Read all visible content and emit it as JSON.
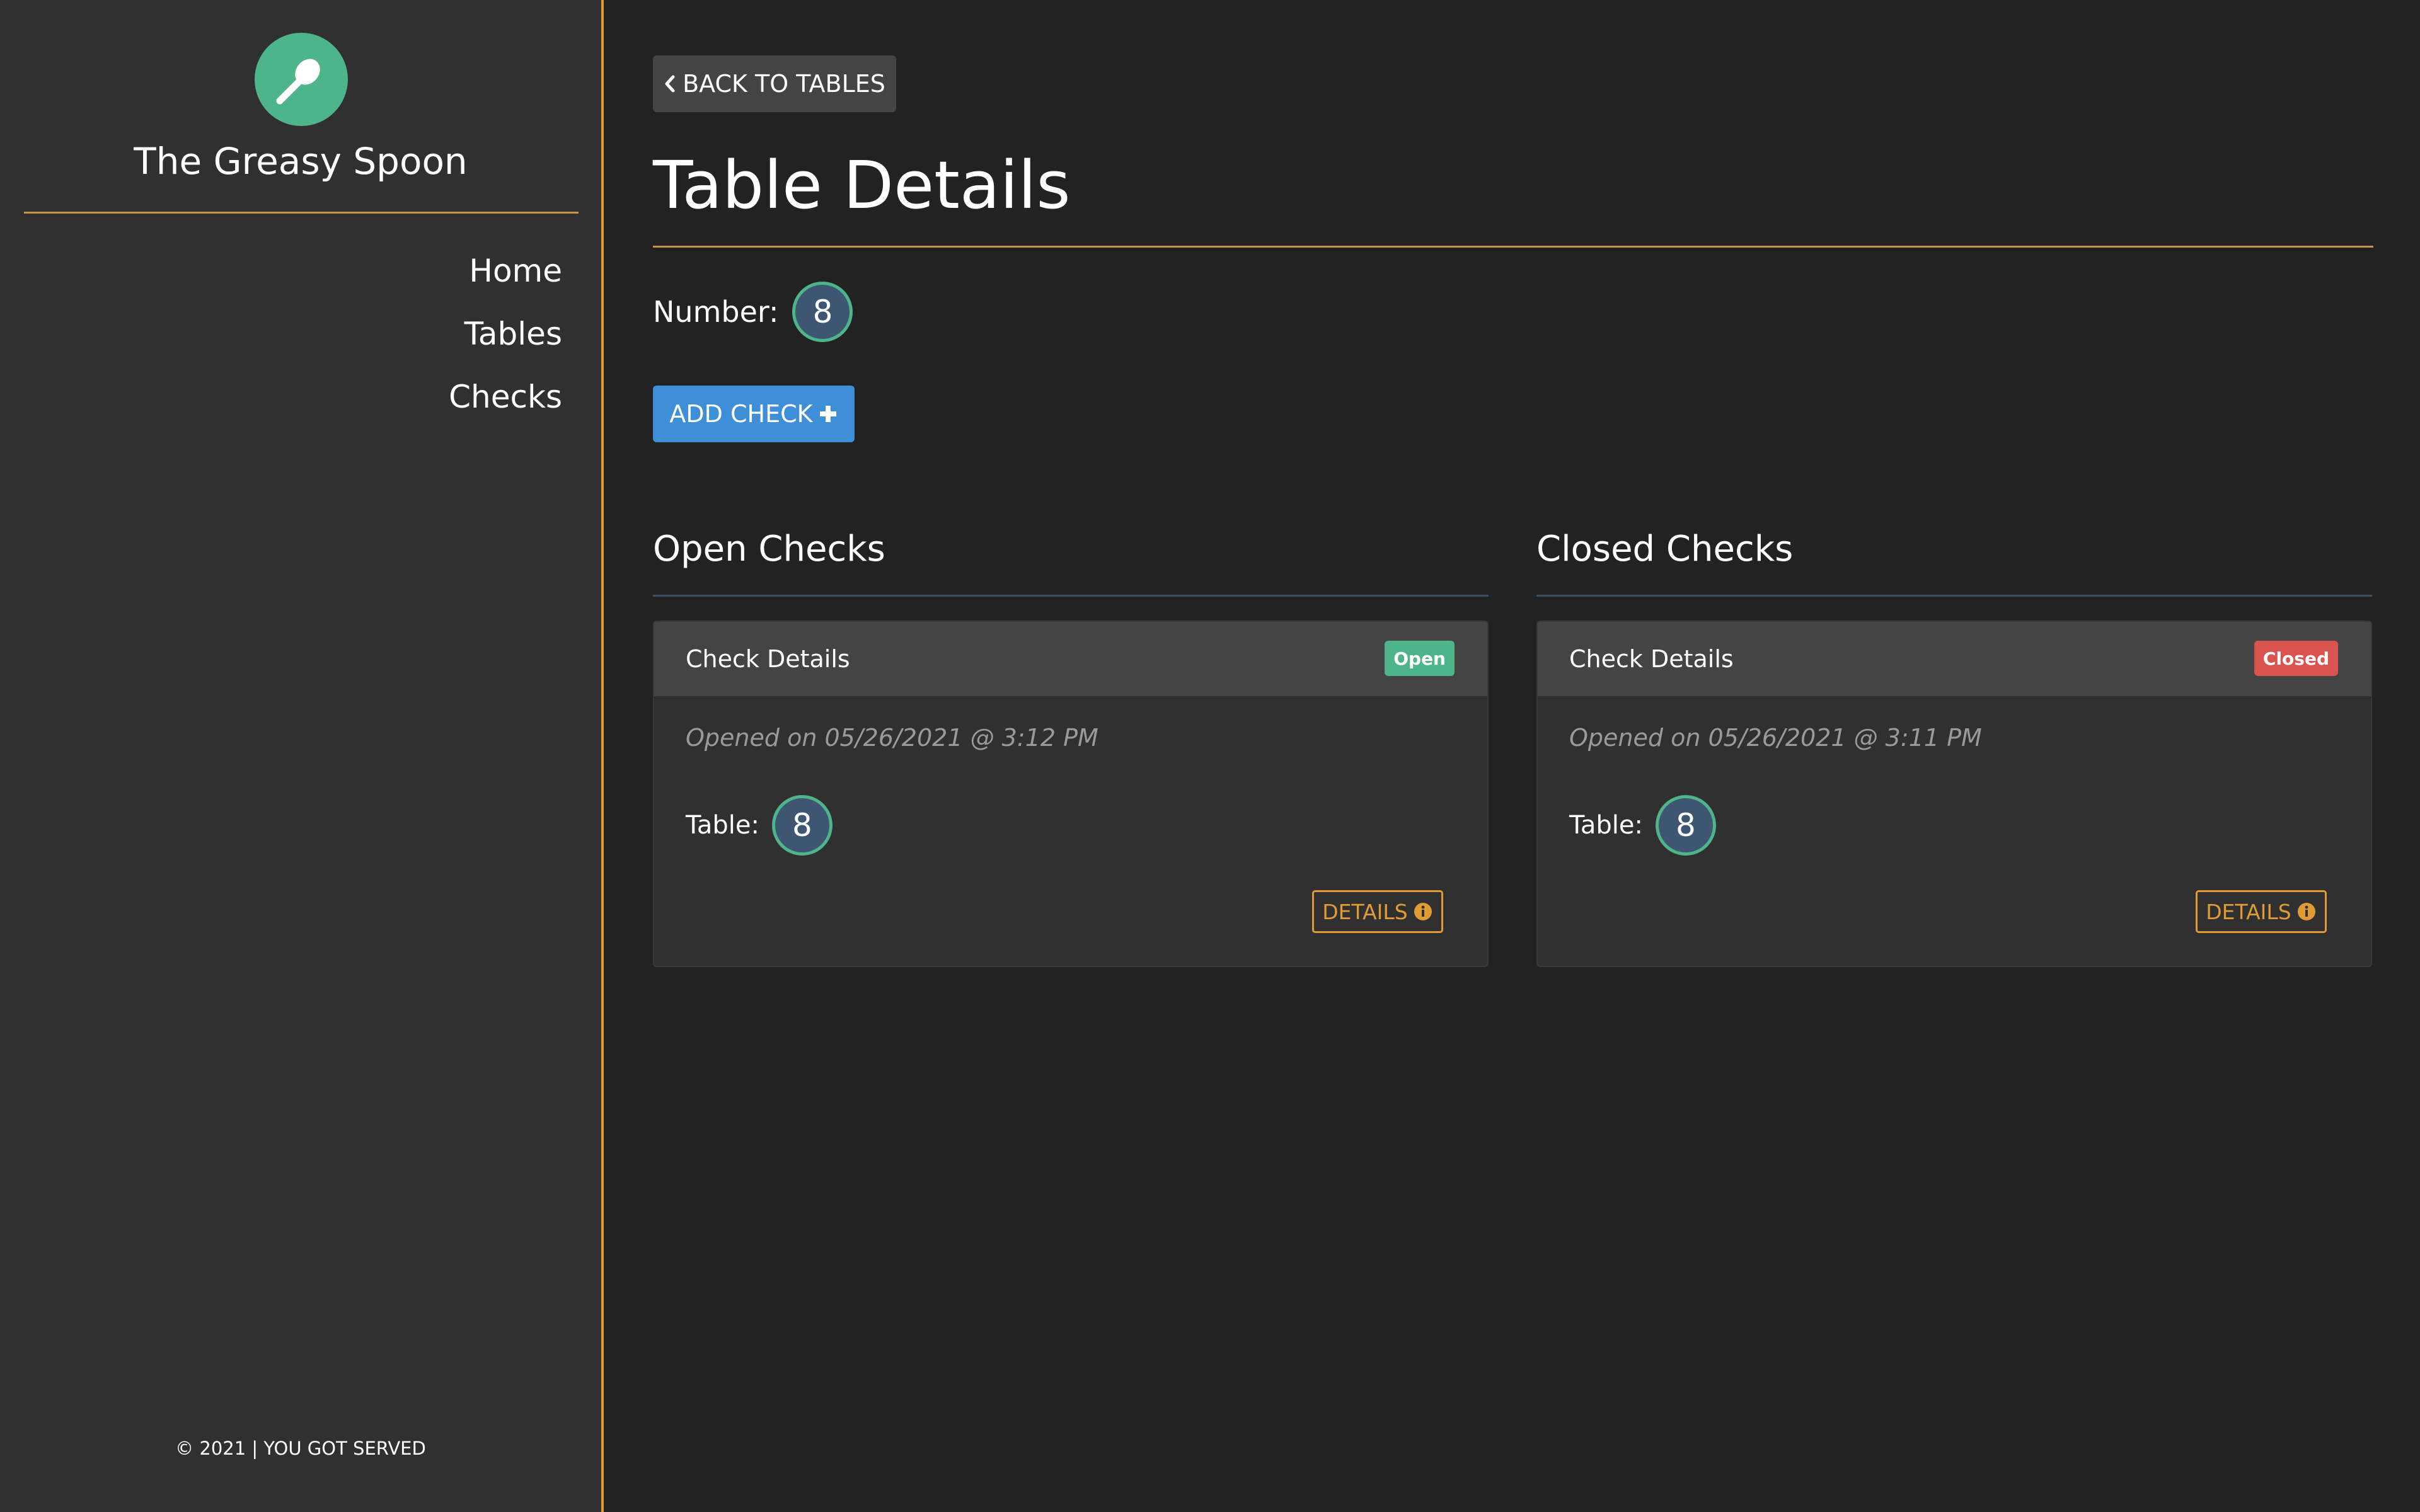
{
  "sidebar": {
    "brand": "The Greasy Spoon",
    "logo_icon": "spoon-icon",
    "nav": [
      {
        "label": "Home"
      },
      {
        "label": "Tables"
      },
      {
        "label": "Checks"
      }
    ],
    "footer": "© 2021 | YOU GOT SERVED"
  },
  "main": {
    "back_label": "BACK TO TABLES",
    "title": "Table Details",
    "number_label": "Number:",
    "number_value": "8",
    "add_check_label": "ADD CHECK",
    "open_section": {
      "title": "Open Checks",
      "cards": [
        {
          "title": "Check Details",
          "status": "Open",
          "opened": "Opened on 05/26/2021 @ 3:12 PM",
          "table_label": "Table:",
          "table_value": "8",
          "details_label": "DETAILS"
        }
      ]
    },
    "closed_section": {
      "title": "Closed Checks",
      "cards": [
        {
          "title": "Check Details",
          "status": "Closed",
          "opened": "Opened on 05/26/2021 @ 3:11 PM",
          "table_label": "Table:",
          "table_value": "8",
          "details_label": "DETAILS"
        }
      ]
    }
  },
  "colors": {
    "accent": "#e09b35",
    "brand_green": "#4eb48a",
    "primary_blue": "#3e8fd8",
    "closed_red": "#d9534f"
  }
}
